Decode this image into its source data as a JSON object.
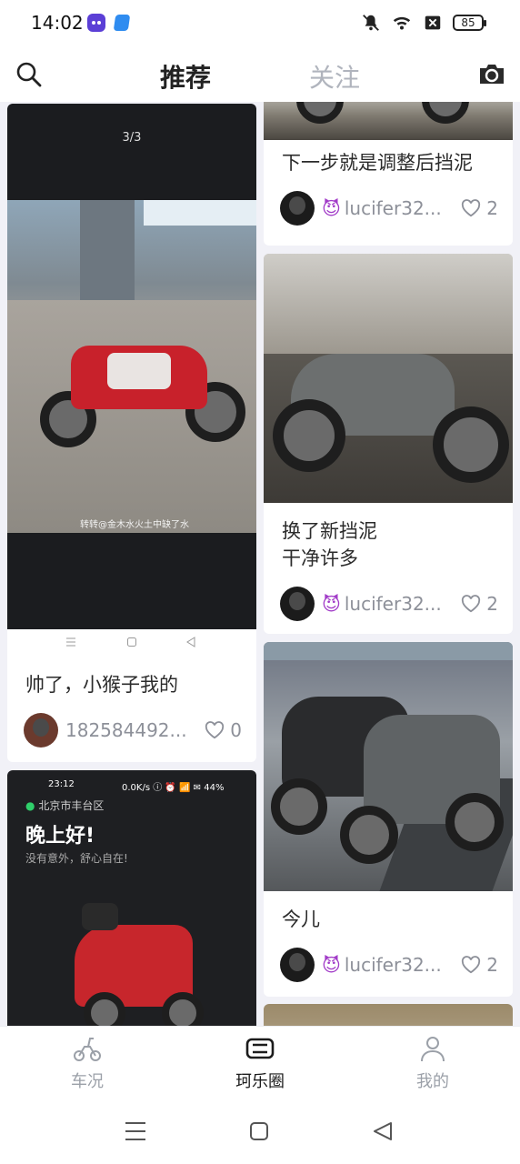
{
  "status": {
    "time": "14:02",
    "battery": "85"
  },
  "header": {
    "tab_recommend": "推荐",
    "tab_follow": "关注"
  },
  "cards": {
    "left1": {
      "counter": "3/3",
      "watermark": "转转@金木水火土中缺了水",
      "title": "帅了，小猴子我的",
      "user": "182584492...",
      "likes": "0"
    },
    "left2": {
      "time": "23:12",
      "net": "0.0K/s ⓘ ⏰ 📶 ✉ 44%",
      "location": "北京市丰台区",
      "greeting": "晚上好!",
      "sub": "没有意外，舒心自在!"
    },
    "right1": {
      "title": "下一步就是调整后挡泥",
      "devil": "😈",
      "user": "lucifer32...",
      "likes": "2"
    },
    "right2": {
      "title": "换了新挡泥\n干净许多",
      "devil": "😈",
      "user": "lucifer32...",
      "likes": "2"
    },
    "right3": {
      "title": "今儿",
      "devil": "😈",
      "user": "lucifer32...",
      "likes": "2"
    }
  },
  "nav": {
    "item1": "车况",
    "item2": "珂乐圈",
    "item3": "我的",
    "active": "珂乐圈"
  },
  "colors": {
    "accent_active": "#1c1c1c",
    "inactive": "#9ba0a8",
    "devil": "#a23cc8",
    "background": "#f1f1f7"
  },
  "icons": [
    "search-icon",
    "camera-icon",
    "heart-icon",
    "scooter-icon",
    "circle-logo-icon",
    "person-icon",
    "menu-icon",
    "home-square-icon",
    "back-triangle-icon"
  ]
}
